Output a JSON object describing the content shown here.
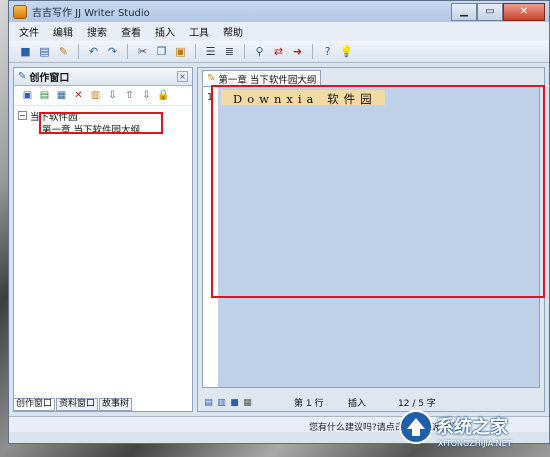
{
  "window": {
    "title": "吉吉写作 JJ Writer Studio"
  },
  "menu": [
    "文件",
    "编辑",
    "搜索",
    "查看",
    "插入",
    "工具",
    "帮助"
  ],
  "toolbar_icons": [
    "new-icon",
    "open-icon",
    "save-icon",
    "undo-icon",
    "redo-icon",
    "cut-icon",
    "copy-icon",
    "paste-icon",
    "indent-icon",
    "outdent-icon",
    "find-icon",
    "replace-icon",
    "goto-icon",
    "help-icon",
    "tip-icon"
  ],
  "left_pane": {
    "title": "创作窗口",
    "tree": {
      "root": "当下软件园",
      "child": "第一章 当下软件园大纲"
    },
    "tabs": [
      "创作窗口",
      "资料窗口",
      "故事树"
    ]
  },
  "editor": {
    "tab_label": "第一章 当下软件园大纲",
    "line_number": "1",
    "line_text": "Downxia 软件园"
  },
  "status": {
    "line": "第 1 行",
    "mode": "插入",
    "count": "12 / 5 字"
  },
  "statusbar": {
    "hint": "您有什么建议吗?请点击这里告诉我们!"
  },
  "watermark": {
    "title": "系统之家",
    "url": "XITONGZHIJIA.NET"
  },
  "colors": {
    "annotation": "#e0141e",
    "editor_bg": "#bed1e8",
    "line_highlight": "#f2d9a6"
  }
}
